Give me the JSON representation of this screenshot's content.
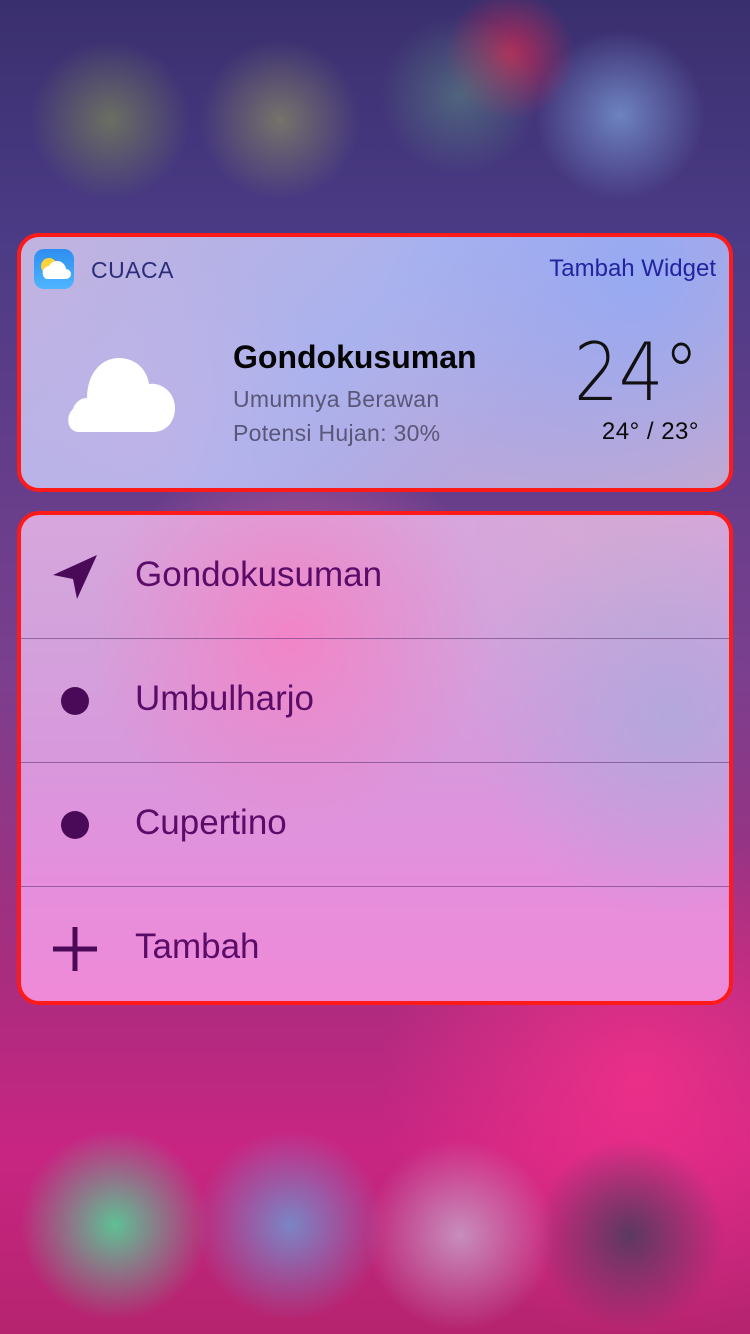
{
  "widget": {
    "app_name": "CUACA",
    "add_widget_label": "Tambah Widget",
    "city": "Gondokusuman",
    "condition": "Umumnya Berawan",
    "rain_chance": "Potensi Hujan: 30%",
    "temperature": "24°",
    "temp_range": "24° / 23°",
    "weather_icon": "cloud-icon",
    "app_icon": "weather-app-icon"
  },
  "menu": {
    "items": [
      {
        "label": "Gondokusuman",
        "icon": "location-arrow-icon"
      },
      {
        "label": "Umbulharjo",
        "icon": "bullet-icon"
      },
      {
        "label": "Cupertino",
        "icon": "bullet-icon"
      },
      {
        "label": "Tambah",
        "icon": "plus-icon"
      }
    ]
  },
  "colors": {
    "highlight_border": "#ff1a1a",
    "menu_text": "#5b0b68",
    "add_widget_link": "#2323a0"
  }
}
